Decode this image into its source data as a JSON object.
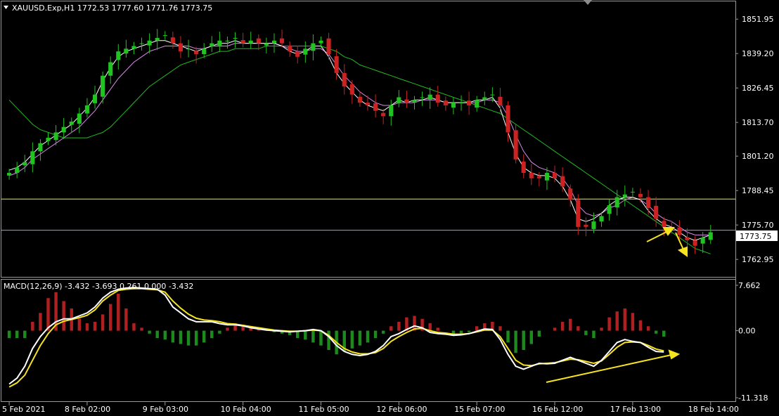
{
  "chart_data": {
    "type": "candlestick",
    "symbol_header": "XAUUSD.Exp,H1  1772.53 1777.60 1771.76 1773.75",
    "current_price_label": "1773.75",
    "ohlc": {
      "open": 1772.53,
      "high": 1777.6,
      "low": 1771.76,
      "close": 1773.75
    },
    "price_axis": {
      "ylim": [
        1757,
        1858
      ],
      "ticks": [
        "1851.95",
        "1839.20",
        "1826.45",
        "1813.70",
        "1801.20",
        "1788.45",
        "1775.70",
        "1762.95"
      ],
      "tick_values": [
        1851.95,
        1839.2,
        1826.45,
        1813.7,
        1801.2,
        1788.45,
        1775.7,
        1762.95
      ]
    },
    "x_axis": {
      "labels": [
        "5 Feb 2021",
        "8 Feb 02:00",
        "9 Feb 03:00",
        "10 Feb 04:00",
        "11 Feb 05:00",
        "12 Feb 06:00",
        "15 Feb 07:00",
        "16 Feb 12:00",
        "17 Feb 13:00",
        "18 Feb 14:00"
      ],
      "label_index": [
        0,
        10,
        20,
        30,
        40,
        50,
        60,
        70,
        80,
        90
      ],
      "count": 97
    },
    "horizontal_lines": [
      {
        "price": 1785.3,
        "color": "#e8e84a"
      },
      {
        "price": 1773.75,
        "color": "#9aa0d8"
      }
    ],
    "close_series": [
      1795,
      1797,
      1799,
      1803,
      1806,
      1808,
      1810,
      1812,
      1814,
      1817,
      1820,
      1824,
      1831,
      1836,
      1840,
      1841,
      1842,
      1843,
      1844,
      1845,
      1846,
      1843,
      1840,
      1841,
      1839,
      1841,
      1843,
      1844,
      1844,
      1845,
      1843,
      1844,
      1843,
      1843,
      1844,
      1843,
      1840,
      1838,
      1841,
      1843,
      1844,
      1839,
      1832,
      1827,
      1824,
      1821,
      1820,
      1818,
      1816,
      1820,
      1823,
      1821,
      1822,
      1823,
      1824,
      1821,
      1820,
      1821,
      1821,
      1820,
      1822,
      1823,
      1824,
      1820,
      1810,
      1800,
      1795,
      1793,
      1793,
      1795,
      1793,
      1790,
      1785,
      1775,
      1775,
      1777,
      1779,
      1783,
      1786,
      1787,
      1788,
      1786,
      1782,
      1778,
      1775,
      1774,
      1772,
      1770,
      1768,
      1771,
      1773
    ],
    "ma_fast_series": [
      1796,
      1797,
      1799,
      1802,
      1805,
      1807,
      1809,
      1811,
      1813,
      1816,
      1819,
      1823,
      1829,
      1834,
      1838,
      1840,
      1841,
      1842,
      1843,
      1844,
      1844,
      1843,
      1842,
      1841,
      1840,
      1841,
      1842,
      1843,
      1843,
      1844,
      1843,
      1843,
      1843,
      1843,
      1843,
      1842,
      1840,
      1839,
      1840,
      1842,
      1842,
      1838,
      1832,
      1828,
      1825,
      1822,
      1820,
      1819,
      1818,
      1820,
      1822,
      1821,
      1822,
      1822,
      1823,
      1822,
      1821,
      1821,
      1821,
      1821,
      1822,
      1822,
      1823,
      1819,
      1810,
      1802,
      1797,
      1795,
      1794,
      1794,
      1793,
      1790,
      1785,
      1778,
      1777,
      1778,
      1780,
      1783,
      1785,
      1786,
      1786,
      1785,
      1781,
      1778,
      1776,
      1775,
      1773,
      1771,
      1770,
      1771,
      1772
    ],
    "ma_slow_series": [
      1794,
      1795,
      1797,
      1800,
      1802,
      1804,
      1806,
      1808,
      1810,
      1812,
      1815,
      1818,
      1822,
      1826,
      1830,
      1833,
      1836,
      1838,
      1840,
      1841,
      1842,
      1842,
      1842,
      1842,
      1841,
      1841,
      1842,
      1842,
      1842,
      1843,
      1843,
      1843,
      1843,
      1843,
      1843,
      1842,
      1841,
      1840,
      1840,
      1841,
      1841,
      1839,
      1835,
      1831,
      1828,
      1825,
      1823,
      1821,
      1820,
      1820,
      1821,
      1821,
      1821,
      1822,
      1822,
      1822,
      1821,
      1821,
      1821,
      1821,
      1821,
      1822,
      1822,
      1821,
      1816,
      1809,
      1803,
      1799,
      1797,
      1796,
      1795,
      1793,
      1789,
      1783,
      1780,
      1779,
      1780,
      1782,
      1783,
      1785,
      1786,
      1785,
      1783,
      1780,
      1778,
      1777,
      1775,
      1773,
      1772,
      1772,
      1772
    ],
    "ma_long_series": [
      1822,
      1819,
      1816,
      1813,
      1811,
      1810,
      1809,
      1808,
      1808,
      1808,
      1808,
      1809,
      1810,
      1812,
      1815,
      1818,
      1821,
      1824,
      1827,
      1829,
      1831,
      1833,
      1835,
      1836,
      1837,
      1838,
      1839,
      1840,
      1840,
      1841,
      1841,
      1841,
      1841,
      1842,
      1842,
      1842,
      1842,
      1842,
      1842,
      1842,
      1842,
      1841,
      1840,
      1838,
      1837,
      1835,
      1834,
      1833,
      1832,
      1831,
      1830,
      1829,
      1828,
      1827,
      1826,
      1825,
      1824,
      1823,
      1822,
      1821,
      1820,
      1819,
      1818,
      1817,
      1815,
      1813,
      1811,
      1809,
      1807,
      1805,
      1803,
      1801,
      1799,
      1797,
      1795,
      1793,
      1791,
      1789,
      1787,
      1785,
      1783,
      1781,
      1779,
      1777,
      1775,
      1773,
      1771,
      1769,
      1767,
      1766,
      1765
    ],
    "colors": {
      "bull": "#21c321",
      "bear": "#cc2222",
      "ma_fast": "#ffffff",
      "ma_mid": "#f0e68c",
      "ma_slow": "#da8be8",
      "ma_long": "#22bb22",
      "macd_line": "#ffffff",
      "signal_line": "#f5e320",
      "hist_pos": "#b02020",
      "hist_neg": "#1d8a1d",
      "annotation": "#f5e320"
    },
    "macd": {
      "label": "MACD(12,26,9) -3.432 -3.693 0.261 0.000 -3.432",
      "ylim": [
        -11.318,
        7.662
      ],
      "ticks": [
        "7.662",
        "0.00",
        "-11.318"
      ],
      "tick_values": [
        7.662,
        0,
        -11.318
      ],
      "macd_series": [
        -9,
        -8,
        -6,
        -3,
        -1,
        0.5,
        1.5,
        2,
        2,
        2.5,
        3,
        4,
        5.5,
        6.5,
        7,
        7.2,
        7.3,
        7.2,
        7.1,
        7,
        6,
        4,
        3,
        2,
        1.5,
        1.5,
        1.5,
        1.2,
        1,
        1,
        0.8,
        0.5,
        0.3,
        0.1,
        0,
        -0.1,
        -0.2,
        -0.1,
        0,
        0.2,
        0,
        -1,
        -2.5,
        -3.5,
        -4,
        -4.2,
        -4,
        -3.5,
        -2.5,
        -1,
        -0.5,
        0.2,
        0.8,
        0.5,
        -0.3,
        -0.5,
        -0.6,
        -0.8,
        -0.7,
        -0.5,
        -0.1,
        0.3,
        0.2,
        -1.5,
        -4,
        -6,
        -6.5,
        -6,
        -5.5,
        -5.6,
        -5.5,
        -5,
        -4.5,
        -5,
        -5.5,
        -6,
        -5,
        -3.5,
        -2,
        -1.5,
        -1.8,
        -2,
        -2.8,
        -3.5,
        -3.6
      ],
      "signal_series": [
        -9.5,
        -8.8,
        -7.5,
        -5,
        -2.5,
        -0.5,
        1,
        1.6,
        1.9,
        2.2,
        2.6,
        3.5,
        5,
        6,
        6.8,
        7,
        7.1,
        7.1,
        7,
        6.9,
        6.5,
        5,
        3.8,
        2.8,
        2.1,
        1.8,
        1.7,
        1.5,
        1.2,
        1.1,
        0.9,
        0.7,
        0.5,
        0.3,
        0.1,
        0,
        -0.1,
        -0.1,
        0,
        0.1,
        0,
        -0.8,
        -2,
        -3,
        -3.6,
        -3.9,
        -3.9,
        -3.7,
        -3,
        -1.8,
        -1,
        -0.3,
        0.3,
        0.4,
        0,
        -0.3,
        -0.4,
        -0.6,
        -0.6,
        -0.5,
        -0.2,
        0.1,
        0.1,
        -1,
        -3,
        -5,
        -5.8,
        -5.9,
        -5.6,
        -5.5,
        -5.4,
        -5.1,
        -4.8,
        -4.9,
        -5.2,
        -5.5,
        -5.1,
        -4,
        -2.8,
        -2,
        -1.9,
        -2,
        -2.5,
        -3.1,
        -3.4
      ],
      "histogram": [
        -0.5,
        -0.5,
        -0.5,
        0.6,
        1.2,
        2.2,
        2.6,
        2,
        1.5,
        0.8,
        0.5,
        0.6,
        1.1,
        1.8,
        2.5,
        1.5,
        0.5,
        0.2,
        -0.2,
        -0.5,
        -0.6,
        -0.8,
        -0.9,
        -1,
        -1,
        -0.8,
        -0.5,
        -0.2,
        0.2,
        0.5,
        0.4,
        0.2,
        0.1,
        0,
        -0.1,
        -0.2,
        -0.3,
        -0.5,
        -0.6,
        -0.8,
        -1,
        -1.3,
        -1.6,
        -1.4,
        -1.2,
        -1,
        -0.8,
        -0.5,
        -0.2,
        0.3,
        0.6,
        0.9,
        1,
        0.8,
        0.5,
        0.2,
        0,
        -0.2,
        -0.2,
        -0.1,
        0.3,
        0.5,
        0.6,
        0.3,
        -0.8,
        -1.5,
        -1.3,
        -0.9,
        -0.4,
        0,
        0.2,
        0.6,
        0.8,
        0.3,
        -0.3,
        -0.5,
        0.2,
        0.9,
        1.3,
        1.5,
        1.2,
        0.7,
        0.3,
        -0.2,
        -0.4
      ]
    }
  }
}
